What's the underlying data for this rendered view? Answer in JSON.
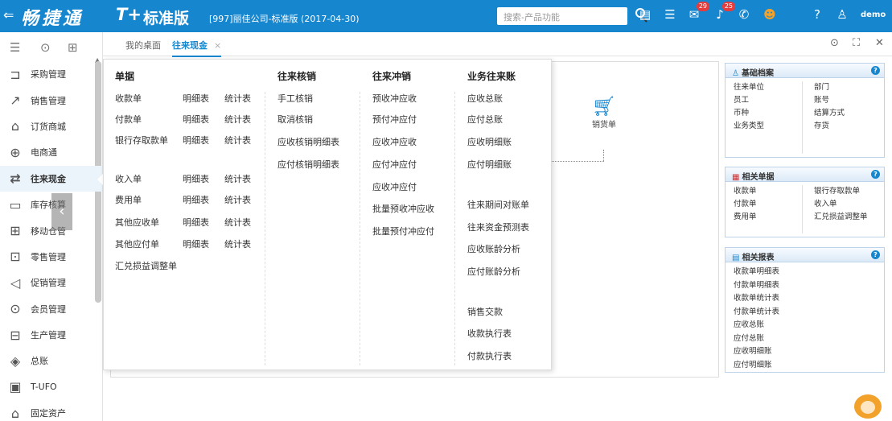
{
  "topbar": {
    "logo_text": "畅捷通",
    "t_logo": "T+",
    "edition": "标准版",
    "company": "[997]丽佳公司-标准版 (2017-04-30)",
    "search_placeholder": "搜索-产品功能",
    "badge_1": "29",
    "badge_2": "25",
    "user": "demo",
    "bg_color": "#1686cf"
  },
  "sidebar": {
    "items": [
      {
        "label": "采购管理",
        "icon": "purchase-icon"
      },
      {
        "label": "销售管理",
        "icon": "sales-chart-icon"
      },
      {
        "label": "订货商城",
        "icon": "shop-icon"
      },
      {
        "label": "电商通",
        "icon": "ecommerce-icon"
      },
      {
        "label": "往来现金",
        "icon": "exchange-icon",
        "active": true
      },
      {
        "label": "库存核算",
        "icon": "inventory-icon"
      },
      {
        "label": "移动仓管",
        "icon": "mobile-warehouse-icon"
      },
      {
        "label": "零售管理",
        "icon": "retail-icon"
      },
      {
        "label": "促销管理",
        "icon": "promotion-icon"
      },
      {
        "label": "会员管理",
        "icon": "member-icon"
      },
      {
        "label": "生产管理",
        "icon": "production-icon"
      },
      {
        "label": "总账",
        "icon": "ledger-icon"
      },
      {
        "label": "T-UFO",
        "icon": "ufo-icon"
      },
      {
        "label": "固定资产",
        "icon": "asset-icon"
      }
    ]
  },
  "tabs": {
    "desktop": "我的桌面",
    "current": "往来现金",
    "close": "×"
  },
  "dropdown": {
    "col1_title": "单据",
    "col1_rows": [
      [
        "收款单",
        "明细表",
        "统计表"
      ],
      [
        "付款单",
        "明细表",
        "统计表"
      ],
      [
        "银行存取款单",
        "明细表",
        "统计表"
      ],
      [
        "收入单",
        "明细表",
        "统计表"
      ],
      [
        "费用单",
        "明细表",
        "统计表"
      ],
      [
        "其他应收单",
        "明细表",
        "统计表"
      ],
      [
        "其他应付单",
        "明细表",
        "统计表"
      ],
      [
        "汇兑损益调整单",
        "",
        ""
      ]
    ],
    "col2_title": "往来核销",
    "col2_items": [
      "手工核销",
      "取消核销",
      "应收核销明细表",
      "应付核销明细表"
    ],
    "col3_title": "往来冲销",
    "col3_items": [
      "预收冲应收",
      "预付冲应付",
      "应收冲应收",
      "应付冲应付",
      "应收冲应付",
      "批量预收冲应收",
      "批量预付冲应付"
    ],
    "col4_title": "业务往来账",
    "col4_items": [
      "应收总账",
      "应付总账",
      "应收明细账",
      "应付明细账",
      "往来期间对账单",
      "往来资金预测表",
      "应收账龄分析",
      "应付账龄分析",
      "销售交款",
      "收款执行表",
      "付款执行表"
    ]
  },
  "canvas": {
    "sales_node": "销货单"
  },
  "panels": {
    "basic": {
      "title": "基础档案",
      "left": [
        "往来单位",
        "员工",
        "币种",
        "业务类型"
      ],
      "right": [
        "部门",
        "账号",
        "结算方式",
        "存货"
      ]
    },
    "docs": {
      "title": "相关单据",
      "left": [
        "收款单",
        "付款单",
        "费用单"
      ],
      "right": [
        "银行存取款单",
        "收入单",
        "汇兑损益调整单"
      ]
    },
    "reports": {
      "title": "相关报表",
      "items": [
        "收款单明细表",
        "付款单明细表",
        "收款单统计表",
        "付款单统计表",
        "应收总账",
        "应付总账",
        "应收明细账",
        "应付明细账"
      ]
    }
  }
}
